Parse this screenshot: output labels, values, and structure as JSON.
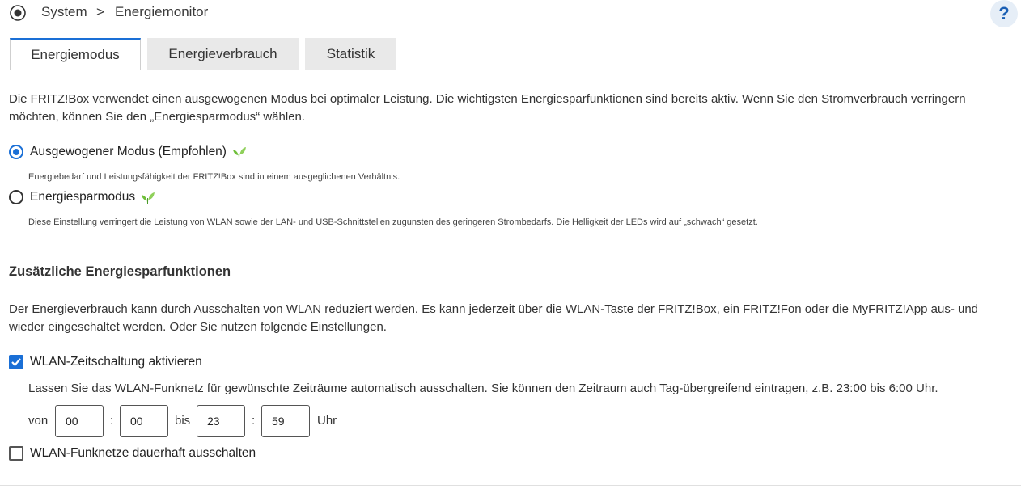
{
  "header": {
    "breadcrumb_root": "System",
    "breadcrumb_sep": ">",
    "breadcrumb_current": "Energiemonitor",
    "help_label": "?"
  },
  "tabs": [
    {
      "label": "Energiemodus",
      "active": true
    },
    {
      "label": "Energieverbrauch",
      "active": false
    },
    {
      "label": "Statistik",
      "active": false
    }
  ],
  "intro": "Die FRITZ!Box verwendet einen ausgewogenen Modus bei optimaler Leistung. Die wichtigsten Energiesparfunktionen sind bereits aktiv. Wenn Sie den Stromverbrauch verringern möchten, können Sie den „Energiesparmodus“ wählen.",
  "modes": [
    {
      "label": "Ausgewogener Modus (Empfohlen)",
      "desc": "Energiebedarf und Leistungsfähigkeit der FRITZ!Box sind in einem ausgeglichenen Verhältnis.",
      "selected": true
    },
    {
      "label": "Energiesparmodus",
      "desc": "Diese Einstellung verringert die Leistung von WLAN sowie der LAN- und USB-Schnittstellen zugunsten des geringeren Strombedarfs. Die Helligkeit der LEDs wird auf „schwach“ gesetzt.",
      "selected": false
    }
  ],
  "extra": {
    "heading": "Zusätzliche Energiesparfunktionen",
    "text": "Der Energieverbrauch kann durch Ausschalten von WLAN reduziert werden. Es kann jederzeit über die WLAN-Taste der FRITZ!Box, ein FRITZ!Fon oder die MyFRITZ!App aus- und wieder eingeschaltet werden. Oder Sie nutzen folgende Einstellungen.",
    "timer_label": "WLAN-Zeitschaltung aktivieren",
    "timer_checked": true,
    "timer_desc": "Lassen Sie das WLAN-Funknetz für gewünschte Zeiträume automatisch ausschalten. Sie können den Zeitraum auch Tag-übergreifend eintragen, z.B. 23:00 bis 6:00 Uhr.",
    "von": "von",
    "bis": "bis",
    "colon": ":",
    "uhr": "Uhr",
    "from_hour": "00",
    "from_min": "00",
    "to_hour": "23",
    "to_min": "59",
    "off_label": "WLAN-Funknetze dauerhaft ausschalten",
    "off_checked": false
  },
  "colors": {
    "accent": "#1a6fd6",
    "leaf": "#6fbf3a"
  }
}
